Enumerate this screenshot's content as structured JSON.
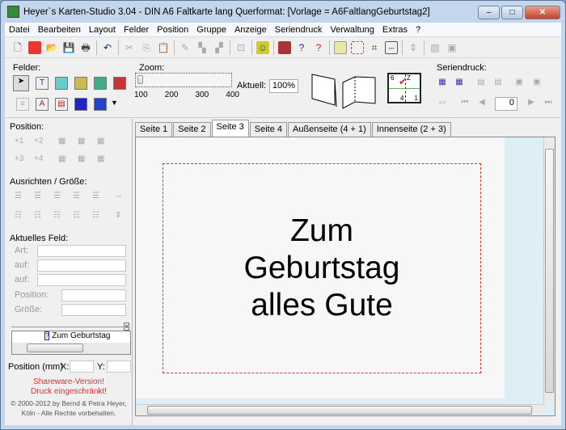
{
  "window": {
    "title": "Heyer`s Karten-Studio 3.04 - DIN A6 Faltkarte lang Querformat: [Vorlage = A6FaltlangGeburtstag2]",
    "min": "–",
    "max": "□",
    "close": "✕"
  },
  "menu": [
    "Datei",
    "Bearbeiten",
    "Layout",
    "Felder",
    "Position",
    "Gruppe",
    "Anzeige",
    "Seriendruck",
    "Verwaltung",
    "Extras",
    "?"
  ],
  "panel": {
    "felder": "Felder:",
    "zoom": "Zoom:",
    "zoom_ticks": [
      "100",
      "200",
      "300",
      "400"
    ],
    "aktuell_label": "Aktuell:",
    "aktuell_value": "100%",
    "seriendruck": "Seriendruck:",
    "record": "0",
    "fold_labels": [
      "6",
      "Z",
      "4",
      "1"
    ]
  },
  "left": {
    "position": "Position:",
    "pos_buttons": [
      "+1",
      "+2",
      "+3",
      "+4"
    ],
    "ausrichten": "Ausrichten / Größe:",
    "aktuelles_feld": "Aktuelles Feld:",
    "art": "Art:",
    "auf1": "auf:",
    "auf2": "auf:",
    "position_label": "Position:",
    "groesse": "Größe:",
    "list_item": "Zum Geburtstag",
    "pos_mm": "Position (mm)",
    "x": "X:",
    "y": "Y:",
    "shareware1": "Shareware-Version!",
    "shareware2": "Druck eingeschränkt!",
    "copyright1": "© 2000-2012 by Bernd & Petra Heyer,",
    "copyright2": "Köln - Alle Rechte vorbehalten."
  },
  "tabs": [
    "Seite 1",
    "Seite 2",
    "Seite 3",
    "Seite 4",
    "Außenseite (4 + 1)",
    "Innenseite (2 + 3)"
  ],
  "card": {
    "line1": "Zum",
    "line2": "Geburtstag",
    "line3": "alles Gute"
  }
}
